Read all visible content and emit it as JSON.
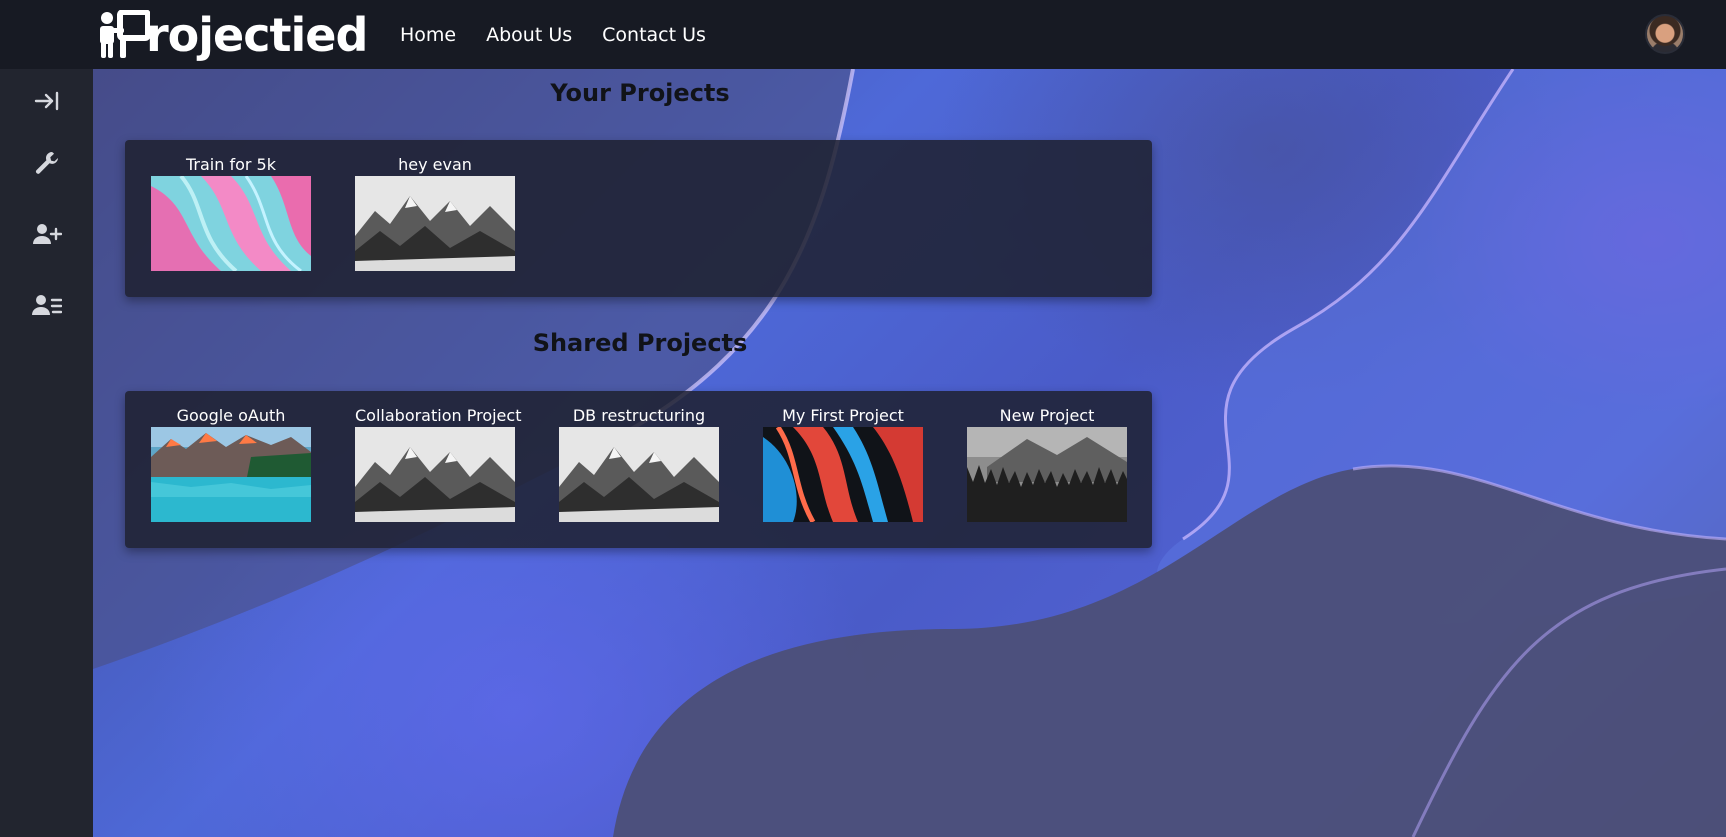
{
  "header": {
    "logo_text": "rojectied",
    "nav": [
      {
        "label": "Home"
      },
      {
        "label": "About Us"
      },
      {
        "label": "Contact Us"
      }
    ],
    "avatar_icon": "user-avatar"
  },
  "sidebar": {
    "items": [
      {
        "icon": "arrow-right-to-bar-icon"
      },
      {
        "icon": "wrench-icon"
      },
      {
        "icon": "user-plus-icon"
      },
      {
        "icon": "user-list-icon"
      }
    ]
  },
  "your_projects": {
    "title": "Your Projects",
    "items": [
      {
        "title": "Train for 5k",
        "thumb": "pink-teal-fluid-art"
      },
      {
        "title": "hey evan",
        "thumb": "grayscale-mountains"
      }
    ]
  },
  "shared_projects": {
    "title": "Shared Projects",
    "items": [
      {
        "title": "Google oAuth",
        "thumb": "mountain-lake"
      },
      {
        "title": "Collaboration Project",
        "thumb": "grayscale-mountains"
      },
      {
        "title": "DB restructuring",
        "thumb": "grayscale-mountains"
      },
      {
        "title": "My First Project",
        "thumb": "red-blue-fluid-art"
      },
      {
        "title": "New Project",
        "thumb": "grayscale-forest"
      }
    ]
  },
  "colors": {
    "topbar": "#171a23",
    "sidebar": "#22252f",
    "panel": "#1e2130"
  }
}
